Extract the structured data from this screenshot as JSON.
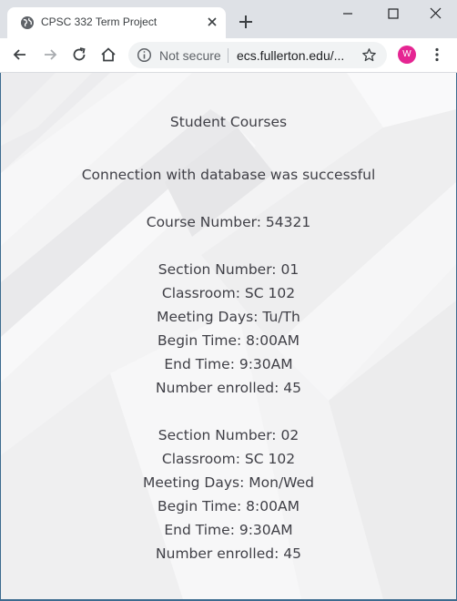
{
  "browser": {
    "tab_title": "CPSC 332 Term Project",
    "security_label": "Not secure",
    "url": "ecs.fullerton.edu/...",
    "avatar_letter": "W",
    "avatar_color": "#e52592",
    "icons": [
      "globe-icon",
      "close-icon",
      "plus-icon",
      "minimize-icon",
      "maximize-icon",
      "window-close-icon",
      "back-arrow-icon",
      "forward-arrow-icon",
      "reload-icon",
      "home-icon",
      "info-icon",
      "star-icon",
      "more-vert-icon"
    ]
  },
  "page": {
    "heading": "Student Courses",
    "status": "Connection with database was successful",
    "course_number": "Course Number: 54321",
    "sections": [
      {
        "section_number": "Section Number: 01",
        "classroom": "Classroom: SC 102",
        "meeting_days": "Meeting Days: Tu/Th",
        "begin_time": "Begin Time: 8:00AM",
        "end_time": "End Time: 9:30AM",
        "enrolled": "Number enrolled: 45"
      },
      {
        "section_number": "Section Number: 02",
        "classroom": "Classroom: SC 102",
        "meeting_days": "Meeting Days: Mon/Wed",
        "begin_time": "Begin Time: 8:00AM",
        "end_time": "End Time: 9:30AM",
        "enrolled": "Number enrolled: 45"
      }
    ]
  }
}
